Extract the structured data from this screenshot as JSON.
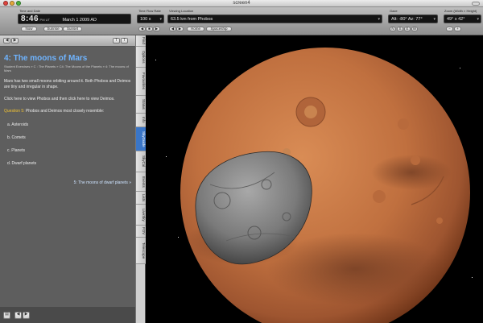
{
  "window": {
    "title": "screen4"
  },
  "toolbar": {
    "time_label": "Time and Date",
    "time_value": "8:46",
    "time_suffix": "PM UT",
    "date_value": "March   1   2009 AD",
    "now_button": "Now",
    "sunrise_button": "Sunrise",
    "sunset_button": "Sunset",
    "flow_label": "Time Flow Rate",
    "flow_value": "100 x",
    "location_label": "Viewing Location",
    "location_value": "63.5 km from Phobos",
    "home_button": "Home",
    "spaceship_button": "Spaceship",
    "gaze_label": "Gaze",
    "gaze_value": "Alt: -80° Az: 77°",
    "compass_n": "N",
    "compass_s": "S",
    "compass_e": "E",
    "compass_w": "W",
    "zoom_label": "Zoom (Width × Height)",
    "zoom_value": "49° x 42°"
  },
  "panel": {
    "heading": "4: The moons of Mars",
    "breadcrumb": "Student Exercises » C : The Planets » C4: The Moons of the Planets » 4: The moons of Mars",
    "intro": "Mars has two small moons orbiting around it. Both Phobos and Deimos are tiny and irregular in shape.",
    "instruction": "Click here to view Phobos and then click here to view Deimos.",
    "question_label": "Question 5:",
    "question_text": "Phobos and Deimos most closely resemble:",
    "options": [
      "a.  Asteroids",
      "b.  Comets",
      "c.  Planets",
      "d.  Dwarf planets"
    ],
    "next_link": "5: The moons of dwarf planets »"
  },
  "tabs": [
    "Find",
    "Options",
    "Favourites",
    "Status",
    "Info",
    "SkyGuide",
    "SkyCal",
    "Events",
    "Lists",
    "LiveSky",
    "FOV",
    "Telescope"
  ],
  "active_tab": "SkyGuide",
  "colors": {
    "heading": "#6fb4ff",
    "question": "#f1c232",
    "active_tab": "#3a76c8",
    "mars": "#c0703f"
  }
}
